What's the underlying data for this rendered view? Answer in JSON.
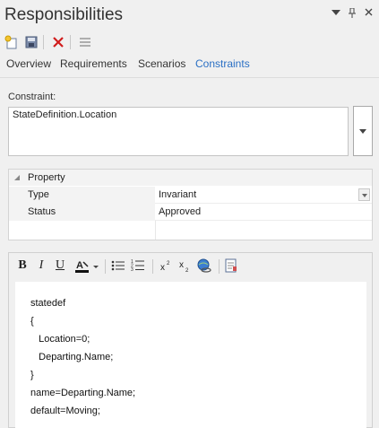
{
  "window": {
    "title": "Responsibilities",
    "controls": [
      "menu-arrow-icon",
      "pin-icon",
      "close-icon"
    ]
  },
  "toolbar": {
    "buttons": [
      "new-icon",
      "save-icon",
      "delete-icon",
      "list-icon"
    ]
  },
  "tabs": [
    {
      "label": "Overview",
      "active": false
    },
    {
      "label": "Requirements",
      "active": false
    },
    {
      "label": "Scenarios",
      "active": false
    },
    {
      "label": "Constraints",
      "active": true
    }
  ],
  "constraint": {
    "label": "Constraint:",
    "value": "StateDefinition.Location"
  },
  "properties": {
    "header": "Property",
    "rows": [
      {
        "name": "Type",
        "value": "Invariant",
        "has_dropdown": true
      },
      {
        "name": "Status",
        "value": "Approved",
        "has_dropdown": false
      }
    ]
  },
  "editor": {
    "toolbar": {
      "bold": "B",
      "italic": "I",
      "underline": "U",
      "buttons": [
        "bold-icon",
        "italic-icon",
        "underline-icon",
        "font-color-icon",
        "bullet-list-icon",
        "numbered-list-icon",
        "superscript-icon",
        "subscript-icon",
        "hyperlink-icon",
        "document-icon"
      ]
    },
    "lines": [
      "statedef",
      "{",
      "   Location=0;",
      "   Departing.Name;",
      "}",
      "name=Departing.Name;",
      "default=Moving;"
    ]
  },
  "colors": {
    "accent": "#2a6fc4",
    "delete": "#d01c1c",
    "background": "#f0f0f0"
  }
}
